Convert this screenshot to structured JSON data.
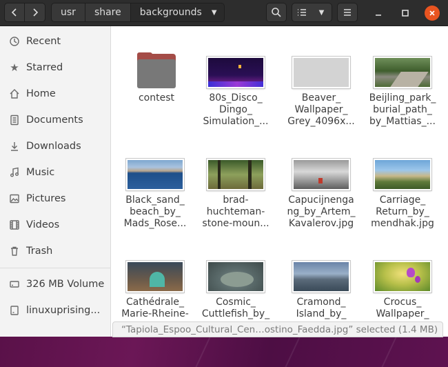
{
  "path": {
    "crumbs": [
      "usr",
      "share",
      "backgrounds"
    ]
  },
  "sidebar": {
    "items": [
      {
        "label": "Recent",
        "icon": "clock-icon"
      },
      {
        "label": "Starred",
        "icon": "star-icon"
      },
      {
        "label": "Home",
        "icon": "home-icon"
      },
      {
        "label": "Documents",
        "icon": "document-icon"
      },
      {
        "label": "Downloads",
        "icon": "download-icon"
      },
      {
        "label": "Music",
        "icon": "music-icon"
      },
      {
        "label": "Pictures",
        "icon": "pictures-icon"
      },
      {
        "label": "Videos",
        "icon": "videos-icon"
      },
      {
        "label": "Trash",
        "icon": "trash-icon"
      }
    ],
    "devices": [
      {
        "label": "326 MB Volume",
        "icon": "drive-icon"
      },
      {
        "label": "linuxuprising...",
        "icon": "drive-icon"
      }
    ]
  },
  "files": [
    {
      "name": "contest",
      "type": "folder"
    },
    {
      "name": "80s_Disco_\nDingo_\nSimulation_...",
      "type": "image"
    },
    {
      "name": "Beaver_\nWallpaper_\nGrey_4096x...",
      "type": "image"
    },
    {
      "name": "Beijling_park_\nburial_path_\nby_Mattias_...",
      "type": "image"
    },
    {
      "name": "Black_sand_\nbeach_by_\nMads_Rose...",
      "type": "image"
    },
    {
      "name": "brad-\nhuchteman-\nstone-moun...",
      "type": "image"
    },
    {
      "name": "Capucijnenga\nng_by_Artem_\nKavalerov.jpg",
      "type": "image"
    },
    {
      "name": "Carriage_\nReturn_by_\nmendhak.jpg",
      "type": "image"
    },
    {
      "name": "Cathédrale_\nMarie-Rheine-",
      "type": "image"
    },
    {
      "name": "Cosmic_\nCuttlefish_by_",
      "type": "image"
    },
    {
      "name": "Cramond_\nIsland_by_",
      "type": "image"
    },
    {
      "name": "Crocus_\nWallpaper_",
      "type": "image"
    }
  ],
  "status": {
    "text": "“Tapiola_Espoo_Cultural_Cen…ostino_Faedda.jpg” selected  (1.4 MB)"
  },
  "colors": {
    "accent": "#e95420",
    "headerbar": "#2d2d2d",
    "folder_back": "#a44c47",
    "folder_front": "#787878"
  }
}
